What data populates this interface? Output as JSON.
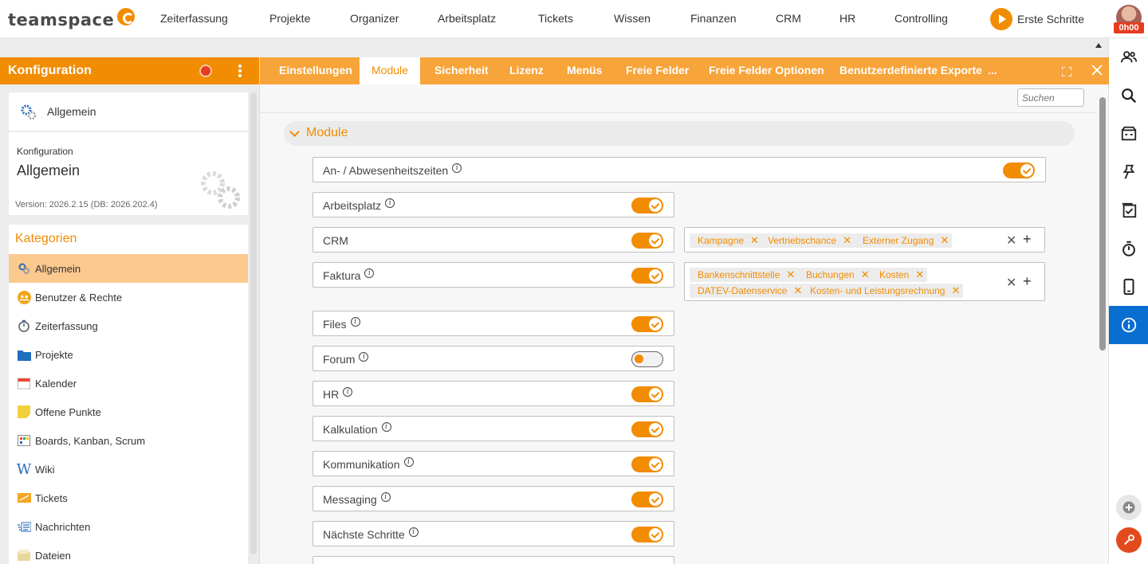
{
  "logo": {
    "text": "teamspace"
  },
  "nav": {
    "items": [
      "Zeiterfassung",
      "Projekte",
      "Organizer",
      "Arbeitsplatz",
      "Tickets",
      "Wissen",
      "Finanzen",
      "CRM",
      "HR",
      "Controlling"
    ],
    "start_label": "Erste Schritte",
    "timer_badge": "0h00"
  },
  "left": {
    "title": "Konfiguration",
    "card1_label": "Allgemein",
    "card2": {
      "caption": "Konfiguration",
      "title": "Allgemein",
      "version": "Version: 2026.2.15 (DB: 2026.202.4)"
    },
    "categories_title": "Kategorien",
    "categories": [
      {
        "label": "Allgemein",
        "icon": "gears-icon"
      },
      {
        "label": "Benutzer & Rechte",
        "icon": "users-icon"
      },
      {
        "label": "Zeiterfassung",
        "icon": "stopwatch-icon"
      },
      {
        "label": "Projekte",
        "icon": "folder-icon"
      },
      {
        "label": "Kalender",
        "icon": "calendar-icon"
      },
      {
        "label": "Offene Punkte",
        "icon": "sticky-note-icon"
      },
      {
        "label": "Boards, Kanban, Scrum",
        "icon": "board-icon"
      },
      {
        "label": "Wiki",
        "icon": "wiki-icon"
      },
      {
        "label": "Tickets",
        "icon": "ticket-icon"
      },
      {
        "label": "Nachrichten",
        "icon": "messages-icon"
      },
      {
        "label": "Dateien",
        "icon": "files-icon"
      }
    ]
  },
  "main": {
    "tabs": [
      "Einstellungen",
      "Module",
      "Sicherheit",
      "Lizenz",
      "Menüs",
      "Freie Felder",
      "Freie Felder Optionen",
      "Benutzerdefinierte Exporte"
    ],
    "tab_more": "...",
    "active_tab": "Module",
    "search_placeholder": "Suchen",
    "section_title": "Module",
    "modules": [
      {
        "label": "An- / Abwesenheitszeiten",
        "on": true,
        "info": true
      },
      {
        "label": "Arbeitsplatz",
        "on": true,
        "info": true
      },
      {
        "label": "CRM",
        "on": true,
        "info": false
      },
      {
        "label": "Faktura",
        "on": true,
        "info": true
      },
      {
        "label": "Files",
        "on": true,
        "info": true
      },
      {
        "label": "Forum",
        "on": false,
        "info": true
      },
      {
        "label": "HR",
        "on": true,
        "info": true
      },
      {
        "label": "Kalkulation",
        "on": true,
        "info": true
      },
      {
        "label": "Kommunikation",
        "on": true,
        "info": true
      },
      {
        "label": "Messaging",
        "on": true,
        "info": true
      },
      {
        "label": "Nächste Schritte",
        "on": true,
        "info": true
      }
    ],
    "crm_chips": [
      "Kampagne",
      "Vertriebschance",
      "Externer Zugang"
    ],
    "faktura_chips": [
      "Bankenschnittstelle",
      "Buchungen",
      "Kosten",
      "DATEV-Datenservice",
      "Kosten- und Leistungsrechnung"
    ]
  },
  "colors": {
    "accent": "#f28c00",
    "tab_bar": "#f7a43a",
    "active_rail": "#0a6ed1"
  }
}
